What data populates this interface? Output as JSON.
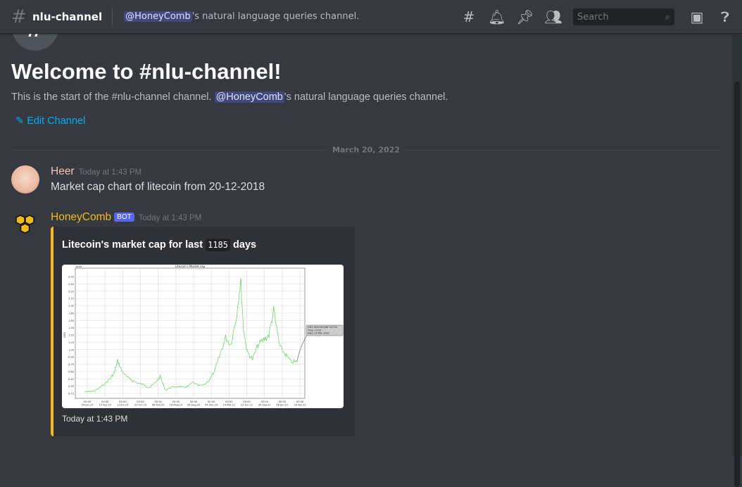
{
  "header": {
    "channel": "nlu-channel",
    "topic_mention": "@HoneyComb",
    "topic_rest": "'s natural language queries channel.",
    "search_placeholder": "Search"
  },
  "welcome": {
    "title": "Welcome to #nlu-channel!",
    "intro_prefix": "This is the start of the #nlu-channel channel.",
    "mention": "@HoneyComb",
    "intro_suffix": "'s natural language queries channel.",
    "edit_label": "Edit Channel"
  },
  "date_divider": "March 20, 2022",
  "messages": [
    {
      "author": "Heer",
      "author_color": "#f4c6b6",
      "time": "Today at 1:43 PM",
      "text": "Market cap chart of litecoin from 20-12-2018"
    },
    {
      "author": "HoneyComb",
      "author_color": "#f2bb1a",
      "badge": "BOT",
      "time": "Today at 1:43 PM",
      "embed": {
        "title_prefix": "Litecoin's market cap for last",
        "days": "1185",
        "title_suffix": "days",
        "footer": "Today at 1:43 PM"
      }
    }
  ],
  "chart_data": {
    "type": "line",
    "title": "Litecoin's Market cap",
    "ylabel": "USD",
    "yscale_label": "1e10",
    "ylim": [
      0.1,
      2.6
    ],
    "yticks": [
      0.15,
      0.3,
      0.45,
      0.6,
      0.75,
      0.9,
      1.05,
      1.2,
      1.35,
      1.5,
      1.65,
      1.8,
      1.95,
      2.1,
      2.25,
      2.4,
      2.55
    ],
    "xtick_time": "00:00",
    "xticks": [
      "04 Jan.19",
      "14 Apr.19",
      "23 Jul.19",
      "31 Oct.19",
      "08 Feb.20",
      "18 May.20",
      "26 Aug.20",
      "04 Dec.20",
      "14 Mar.21",
      "22 Jun.21",
      "30 Sep.21",
      "08 Jan.22",
      "18 Apr.22"
    ],
    "x": [
      "2018-12-20",
      "2019-01-15",
      "2019-02-15",
      "2019-03-15",
      "2019-04-15",
      "2019-05-15",
      "2019-06-05",
      "2019-06-22",
      "2019-07-15",
      "2019-08-15",
      "2019-09-15",
      "2019-10-15",
      "2019-11-15",
      "2019-12-15",
      "2020-01-15",
      "2020-02-15",
      "2020-03-15",
      "2020-04-15",
      "2020-05-15",
      "2020-06-15",
      "2020-07-15",
      "2020-08-15",
      "2020-09-15",
      "2020-10-15",
      "2020-11-15",
      "2020-12-15",
      "2021-01-15",
      "2021-02-15",
      "2021-03-15",
      "2021-04-15",
      "2021-05-10",
      "2021-05-25",
      "2021-06-15",
      "2021-07-15",
      "2021-08-15",
      "2021-09-15",
      "2021-10-15",
      "2021-11-10",
      "2021-12-15",
      "2022-01-15",
      "2022-02-15",
      "2022-03-20"
    ],
    "series": [
      {
        "name": "Litecoin market cap",
        "color": "#55d655",
        "values": [
          0.18,
          0.19,
          0.2,
          0.27,
          0.36,
          0.47,
          0.58,
          0.82,
          0.62,
          0.48,
          0.41,
          0.36,
          0.33,
          0.27,
          0.35,
          0.5,
          0.22,
          0.27,
          0.29,
          0.28,
          0.28,
          0.38,
          0.31,
          0.32,
          0.42,
          0.6,
          0.95,
          1.3,
          1.15,
          1.7,
          2.5,
          1.5,
          1.0,
          0.85,
          1.15,
          1.25,
          1.35,
          1.85,
          1.1,
          0.95,
          0.8,
          0.8
        ]
      }
    ],
    "tooltip": {
      "usd": "USD: 8052161266.742794",
      "time": "Time: 13:43",
      "date": "Date: 20 Mar. 2022"
    }
  }
}
